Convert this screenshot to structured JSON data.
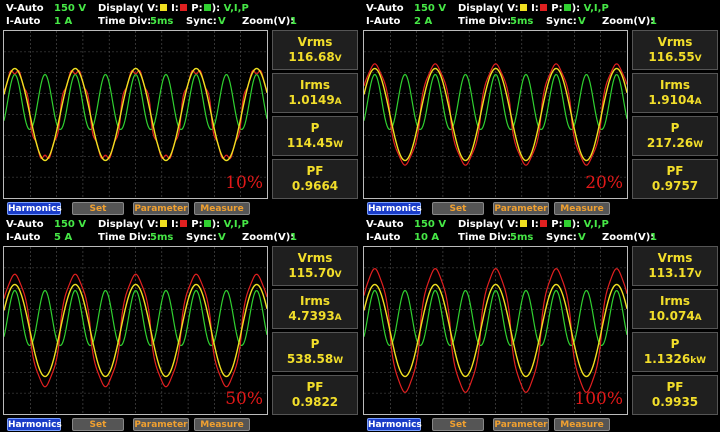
{
  "colors": {
    "voltage": "#f0e020",
    "current": "#e02020",
    "power": "#30d030",
    "grid": "#555555",
    "meas_text": "#f2de2a"
  },
  "header_labels": {
    "v_auto": "V-Auto",
    "i_auto": "I-Auto",
    "display": "Display( V:",
    "i": "I:",
    "p": "P:",
    "display_end": "):",
    "time_div": "Time Div:",
    "sync": "Sync:",
    "zoom": "Zoom(V):"
  },
  "measure_labels": {
    "vrms": "Vrms",
    "irms": "Irms",
    "p": "P",
    "pf": "PF"
  },
  "buttons": {
    "harmonics": "Harmonics",
    "set": "Set",
    "parameter": "Parameter",
    "measure": "Measure"
  },
  "panels": [
    {
      "v_range": "150 V",
      "i_range": "1 A",
      "display_value": "V,I,P",
      "time_div": "5ms",
      "sync": "V",
      "zoom": "1",
      "vrms": "116.68",
      "vrms_unit": "V",
      "irms": "1.0149",
      "irms_unit": "A",
      "p": "114.45",
      "p_unit": "W",
      "pf": "0.9664",
      "load": "10%",
      "current_level": 0.6
    },
    {
      "v_range": "150 V",
      "i_range": "2 A",
      "display_value": "V,I,P",
      "time_div": "5ms",
      "sync": "V",
      "zoom": "1",
      "vrms": "116.55",
      "vrms_unit": "V",
      "irms": "1.9104",
      "irms_unit": "A",
      "p": "217.26",
      "p_unit": "W",
      "pf": "0.9757",
      "load": "20%",
      "current_level": 0.7
    },
    {
      "v_range": "150 V",
      "i_range": "5 A",
      "display_value": "V,I,P",
      "time_div": "5ms",
      "sync": "V",
      "zoom": "1",
      "vrms": "115.70",
      "vrms_unit": "V",
      "irms": "4.7393",
      "irms_unit": "A",
      "p": "538.58",
      "p_unit": "W",
      "pf": "0.9822",
      "load": "50%",
      "current_level": 0.8
    },
    {
      "v_range": "150 V",
      "i_range": "10 A",
      "display_value": "V,I,P",
      "time_div": "5ms",
      "sync": "V",
      "zoom": "1",
      "vrms": "113.17",
      "vrms_unit": "V",
      "irms": "10.074",
      "irms_unit": "A",
      "p": "1.1326",
      "p_unit": "kW",
      "pf": "0.9935",
      "load": "100%",
      "current_level": 0.9
    }
  ]
}
